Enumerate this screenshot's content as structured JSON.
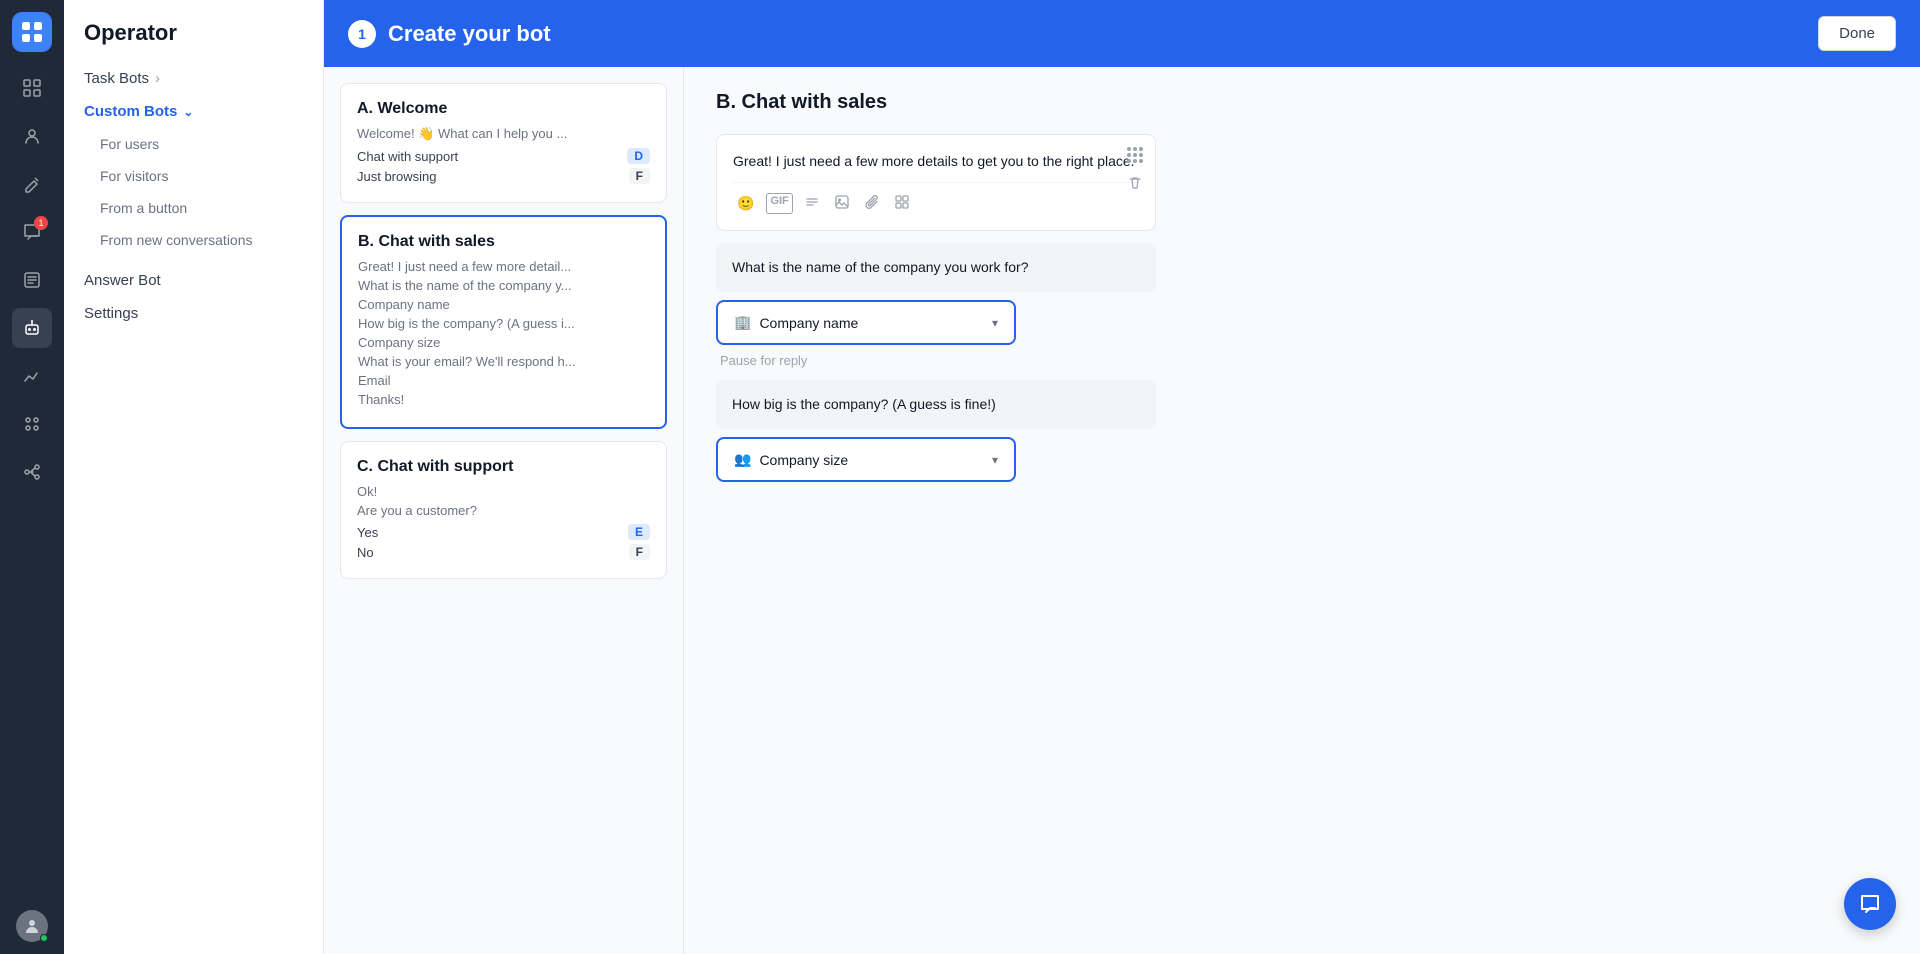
{
  "app": {
    "logo_char": "≡",
    "operator_title": "Operator"
  },
  "icon_nav": [
    {
      "name": "grid-icon",
      "symbol": "⊞",
      "active": false
    },
    {
      "name": "users-icon",
      "symbol": "👥",
      "active": false
    },
    {
      "name": "brush-icon",
      "symbol": "✏️",
      "active": false
    },
    {
      "name": "chat-icon",
      "symbol": "💬",
      "badge": "1",
      "active": false
    },
    {
      "name": "tasks-icon",
      "symbol": "☰",
      "active": false
    },
    {
      "name": "bot-icon",
      "symbol": "🤖",
      "active": true
    },
    {
      "name": "reports-icon",
      "symbol": "📊",
      "active": false
    },
    {
      "name": "apps-icon",
      "symbol": "⊞",
      "active": false
    },
    {
      "name": "integrations-icon",
      "symbol": "🔗",
      "active": false
    }
  ],
  "sidebar": {
    "task_bots_label": "Task Bots",
    "custom_bots_label": "Custom Bots",
    "sub_items": [
      {
        "label": "For users"
      },
      {
        "label": "For visitors"
      },
      {
        "label": "From a button"
      },
      {
        "label": "From new conversations"
      }
    ],
    "answer_bot_label": "Answer Bot",
    "settings_label": "Settings"
  },
  "header": {
    "step_number": "1",
    "title": "Create your bot",
    "done_label": "Done"
  },
  "bot_list": [
    {
      "label": "A. Welcome",
      "text": "Welcome! 👋  What can I help you ...",
      "options": [
        {
          "text": "Chat with support",
          "badge": "D",
          "badge_style": "blue"
        },
        {
          "text": "Just browsing",
          "badge": "F",
          "badge_style": "gray"
        }
      ],
      "selected": false
    },
    {
      "label": "B. Chat with sales",
      "text": "Great! I just need a few more detail...",
      "lines": [
        "What is the name of the company y...",
        "Company name",
        "How big is the company? (A guess i...",
        "Company size",
        "What is your email? We'll respond h...",
        "Email",
        "Thanks!"
      ],
      "options": [],
      "selected": true
    },
    {
      "label": "C. Chat with support",
      "text": "Ok!",
      "lines": [
        "Are you a customer?"
      ],
      "options": [
        {
          "text": "Yes",
          "badge": "E",
          "badge_style": "blue"
        },
        {
          "text": "No",
          "badge": "F",
          "badge_style": "gray"
        }
      ],
      "selected": false
    }
  ],
  "editor": {
    "title": "B. Chat with sales",
    "messages": [
      {
        "id": "msg1",
        "text": "Great! I just need a few more details to get you to the right place.",
        "has_toolbar": true
      }
    ],
    "question_block": {
      "text": "What is the name of the company you work for?"
    },
    "save1": {
      "icon": "🏢",
      "label": "Company name"
    },
    "pause1": "Pause for reply",
    "question_block2": {
      "text": "How big is the company? (A guess is fine!)"
    },
    "save2": {
      "icon": "👥",
      "label": "Company size"
    }
  }
}
